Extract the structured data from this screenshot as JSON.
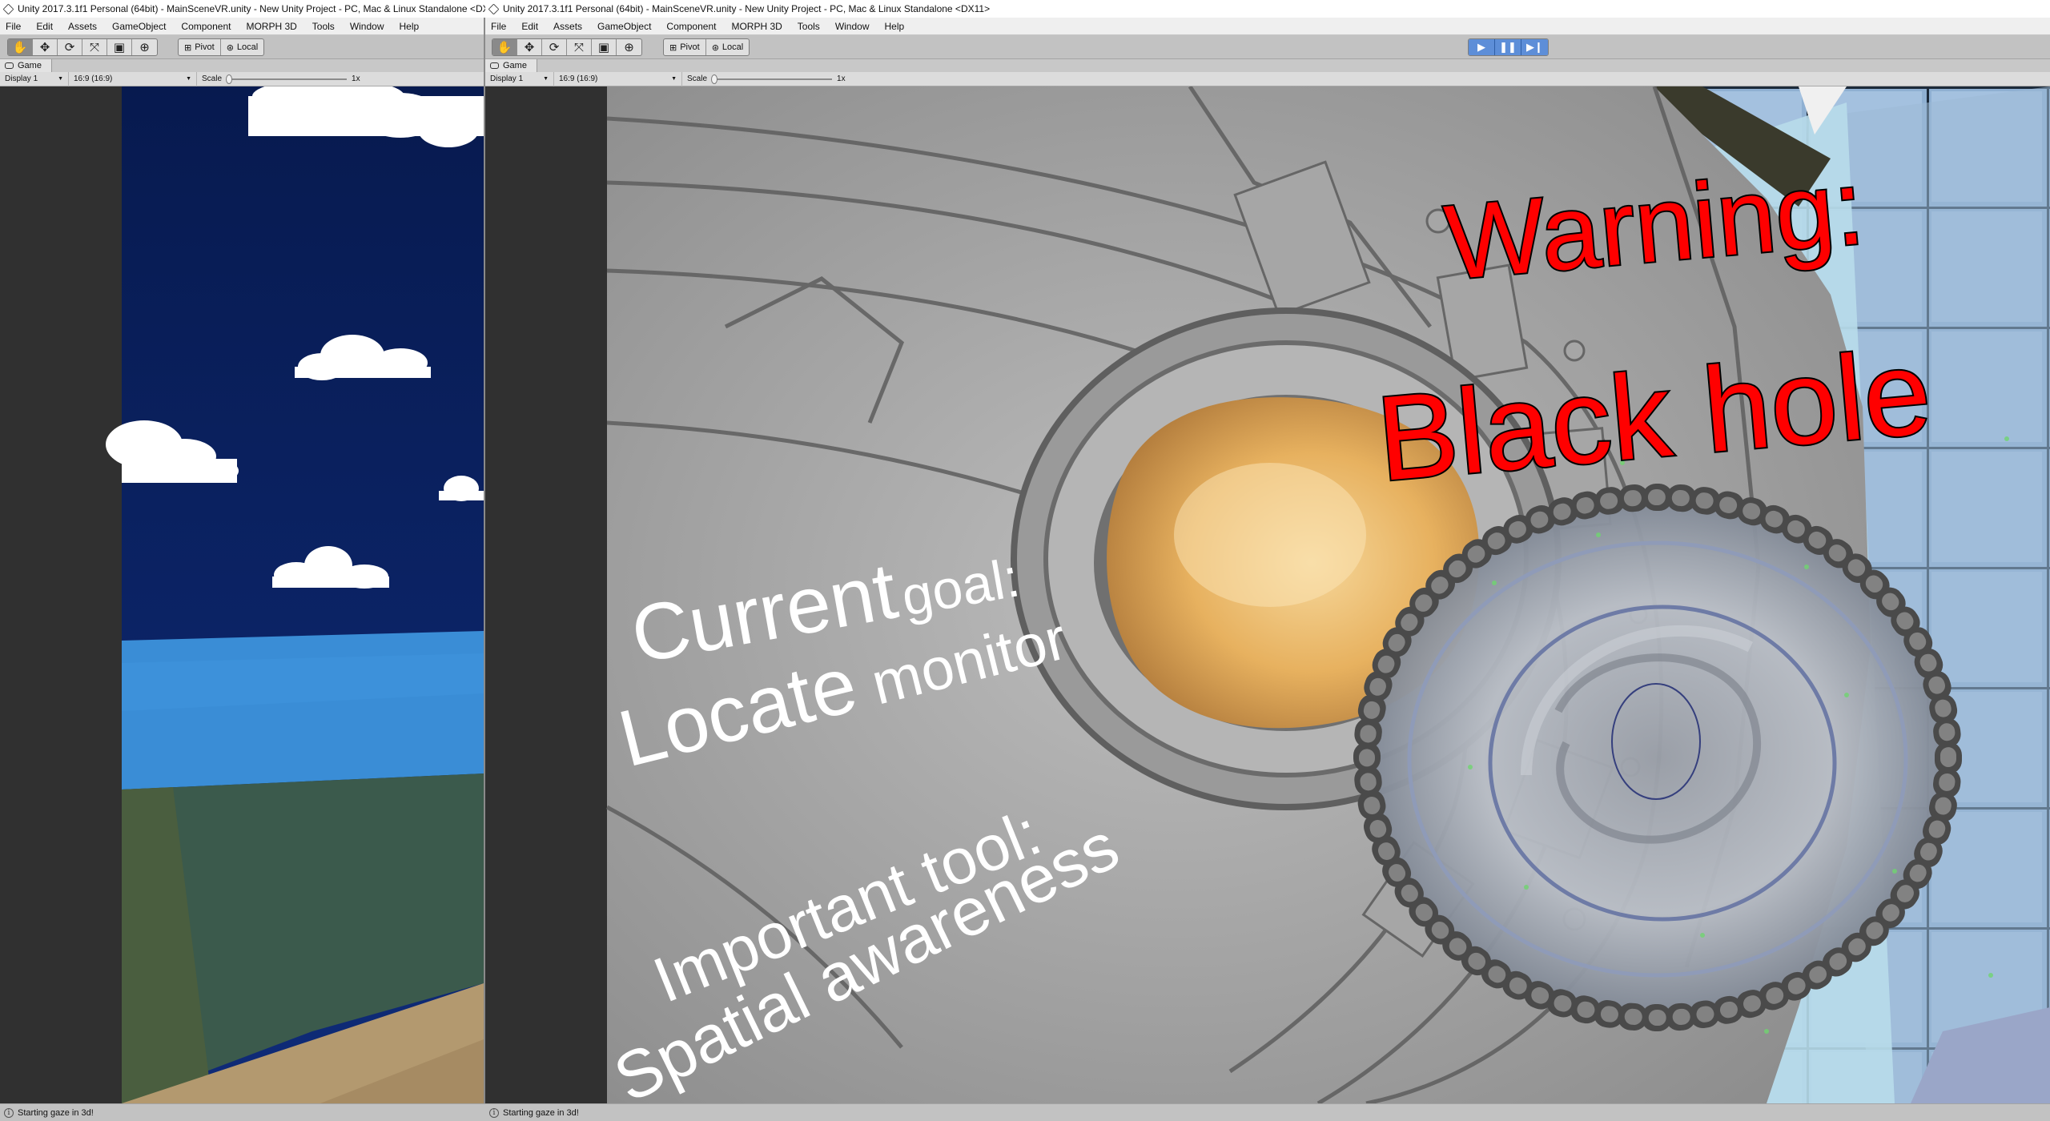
{
  "windows": [
    {
      "title": "Unity 2017.3.1f1 Personal (64bit) - MainSceneVR.unity - New Unity Project - PC, Mac & Linux Standalone <DX1",
      "status": "Starting gaze in 3d!"
    },
    {
      "title": "Unity 2017.3.1f1 Personal (64bit) - MainSceneVR.unity - New Unity Project - PC, Mac & Linux Standalone <DX11>",
      "status": "Starting gaze in 3d!"
    }
  ],
  "menu": [
    "File",
    "Edit",
    "Assets",
    "GameObject",
    "Component",
    "MORPH 3D",
    "Tools",
    "Window",
    "Help"
  ],
  "toolbar": {
    "tools": [
      "hand-icon",
      "move-icon",
      "rotate-icon",
      "scale-icon",
      "rect-icon",
      "transform-icon"
    ],
    "pivot_label": "Pivot",
    "local_label": "Local",
    "play_controls": [
      "play-icon",
      "pause-icon",
      "step-icon"
    ],
    "play_color": "#5d8ed8"
  },
  "game_view": {
    "tab_label": "Game",
    "display": "Display 1",
    "aspect": "16:9 (16:9)",
    "scale_label": "Scale",
    "scale_value": "1x"
  },
  "scene_text": {
    "warning_line1": "Warning:",
    "warning_line2": "Black hole",
    "warning_color": "#ff0000",
    "goal_line1_a": "Current",
    "goal_line1_b": "goal:",
    "goal_line2_a": "Locate",
    "goal_line2_b": "monitor",
    "tool_line1": "Important tool:",
    "tool_line2": "Spatial awareness"
  }
}
